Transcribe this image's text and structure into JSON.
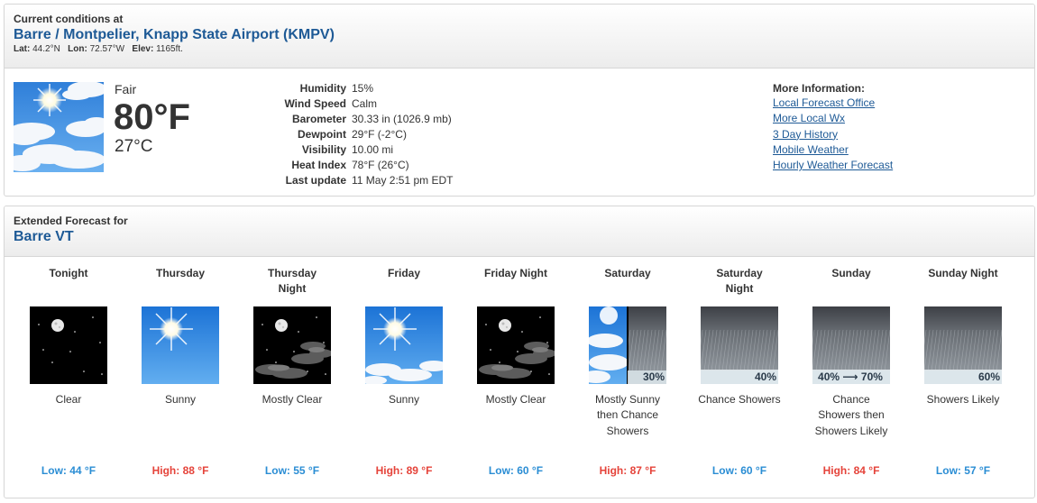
{
  "current": {
    "label": "Current conditions at",
    "station": "Barre / Montpelier, Knapp State Airport (KMPV)",
    "lat_label": "Lat:",
    "lat": "44.2°N",
    "lon_label": "Lon:",
    "lon": "72.57°W",
    "elev_label": "Elev:",
    "elev": "1165ft.",
    "icon": "sunny-partly-cloudy-icon",
    "condition": "Fair",
    "temp_f": "80°F",
    "temp_c": "27°C",
    "details": [
      {
        "key": "Humidity",
        "value": "15%"
      },
      {
        "key": "Wind Speed",
        "value": "Calm"
      },
      {
        "key": "Barometer",
        "value": "30.33 in (1026.9 mb)"
      },
      {
        "key": "Dewpoint",
        "value": "29°F (-2°C)"
      },
      {
        "key": "Visibility",
        "value": "10.00 mi"
      },
      {
        "key": "Heat Index",
        "value": "78°F (26°C)"
      },
      {
        "key": "Last update",
        "value": "11 May 2:51 pm EDT"
      }
    ],
    "more_info_label": "More Information:",
    "links": [
      "Local Forecast Office",
      "More Local Wx",
      "3 Day History",
      "Mobile Weather",
      "Hourly Weather Forecast"
    ]
  },
  "forecast": {
    "label": "Extended Forecast for",
    "location": "Barre VT",
    "days": [
      {
        "name": "Tonight",
        "icon": "night-clear-icon",
        "desc": "Clear",
        "temp_label": "Low: 44 °F",
        "temp_type": "low",
        "pop": ""
      },
      {
        "name": "Thursday",
        "icon": "sunny-icon",
        "desc": "Sunny",
        "temp_label": "High: 88 °F",
        "temp_type": "high",
        "pop": ""
      },
      {
        "name": "Thursday Night",
        "icon": "night-mostly-clear-icon",
        "desc": "Mostly Clear",
        "temp_label": "Low: 55 °F",
        "temp_type": "low",
        "pop": ""
      },
      {
        "name": "Friday",
        "icon": "sunny-clouds-icon",
        "desc": "Sunny",
        "temp_label": "High: 89 °F",
        "temp_type": "high",
        "pop": ""
      },
      {
        "name": "Friday Night",
        "icon": "night-mostly-clear-icon",
        "desc": "Mostly Clear",
        "temp_label": "Low: 60 °F",
        "temp_type": "low",
        "pop": ""
      },
      {
        "name": "Saturday",
        "icon": "mostly-sunny-then-showers-icon",
        "desc": "Mostly Sunny then Chance Showers",
        "temp_label": "High: 87 °F",
        "temp_type": "high",
        "pop": "30%"
      },
      {
        "name": "Saturday Night",
        "icon": "showers-icon",
        "desc": "Chance Showers",
        "temp_label": "Low: 60 °F",
        "temp_type": "low",
        "pop": "40%"
      },
      {
        "name": "Sunday",
        "icon": "showers-icon",
        "desc": "Chance Showers then Showers Likely",
        "temp_label": "High: 84 °F",
        "temp_type": "high",
        "pop": "40% ⟶ 70%"
      },
      {
        "name": "Sunday Night",
        "icon": "showers-icon",
        "desc": "Showers Likely",
        "temp_label": "Low: 57 °F",
        "temp_type": "low",
        "pop": "60%"
      }
    ]
  },
  "colors": {
    "link": "#1e5a96",
    "low": "#2a8dd4",
    "high": "#e5433a"
  }
}
